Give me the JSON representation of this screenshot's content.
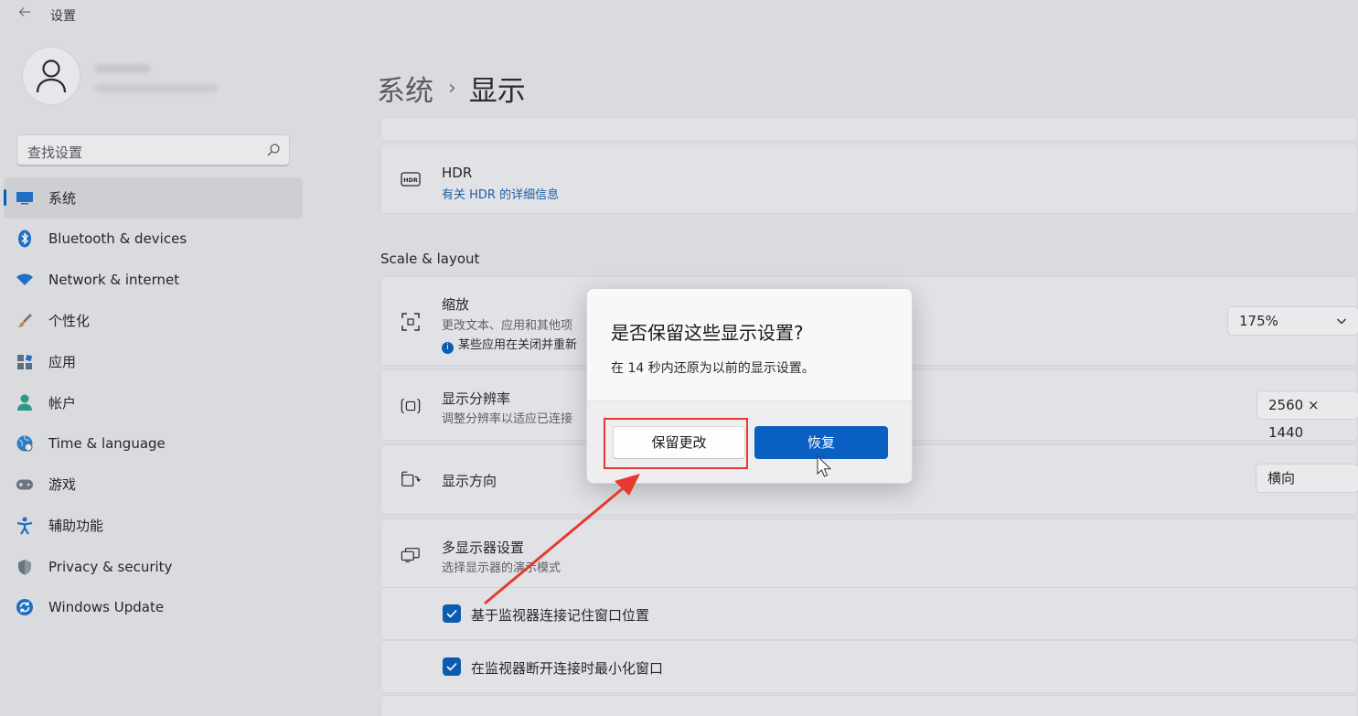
{
  "app": {
    "title": "设置",
    "back_icon": "back-arrow-icon"
  },
  "search": {
    "placeholder": "查找设置"
  },
  "nav": {
    "items": [
      {
        "label": "系统",
        "icon": "display-icon",
        "active": true
      },
      {
        "label": "Bluetooth & devices",
        "icon": "bluetooth-icon"
      },
      {
        "label": "Network & internet",
        "icon": "wifi-icon"
      },
      {
        "label": "个性化",
        "icon": "brush-icon"
      },
      {
        "label": "应用",
        "icon": "apps-icon"
      },
      {
        "label": "帐户",
        "icon": "person-icon"
      },
      {
        "label": "Time & language",
        "icon": "globe-clock-icon"
      },
      {
        "label": "游戏",
        "icon": "gamepad-icon"
      },
      {
        "label": "辅助功能",
        "icon": "accessibility-icon"
      },
      {
        "label": "Privacy & security",
        "icon": "shield-icon"
      },
      {
        "label": "Windows Update",
        "icon": "update-icon"
      }
    ]
  },
  "breadcrumb": {
    "parent": "系统",
    "separator": "›",
    "current": "显示"
  },
  "content": {
    "hdr": {
      "title": "HDR",
      "link": "有关 HDR 的详细信息"
    },
    "section_scale": "Scale & layout",
    "scale": {
      "title": "缩放",
      "sub": "更改文本、应用和其他项",
      "info": "某些应用在关闭并重新",
      "value": "175%"
    },
    "resolution": {
      "title": "显示分辨率",
      "sub": "调整分辨率以适应已连接",
      "value": "2560 × 1440"
    },
    "orientation": {
      "title": "显示方向",
      "value": "横向"
    },
    "multi": {
      "title": "多显示器设置",
      "sub": "选择显示器的演示模式"
    },
    "check1": {
      "label": "基于监视器连接记住窗口位置",
      "checked": true
    },
    "check2": {
      "label": "在监视器断开连接时最小化窗口",
      "checked": true
    }
  },
  "dialog": {
    "title": "是否保留这些显示设置?",
    "message": "在 14 秒内还原为以前的显示设置。",
    "keep_label": "保留更改",
    "revert_label": "恢复"
  },
  "colors": {
    "accent": "#0a5fc2",
    "annotation": "#e63a2f"
  }
}
